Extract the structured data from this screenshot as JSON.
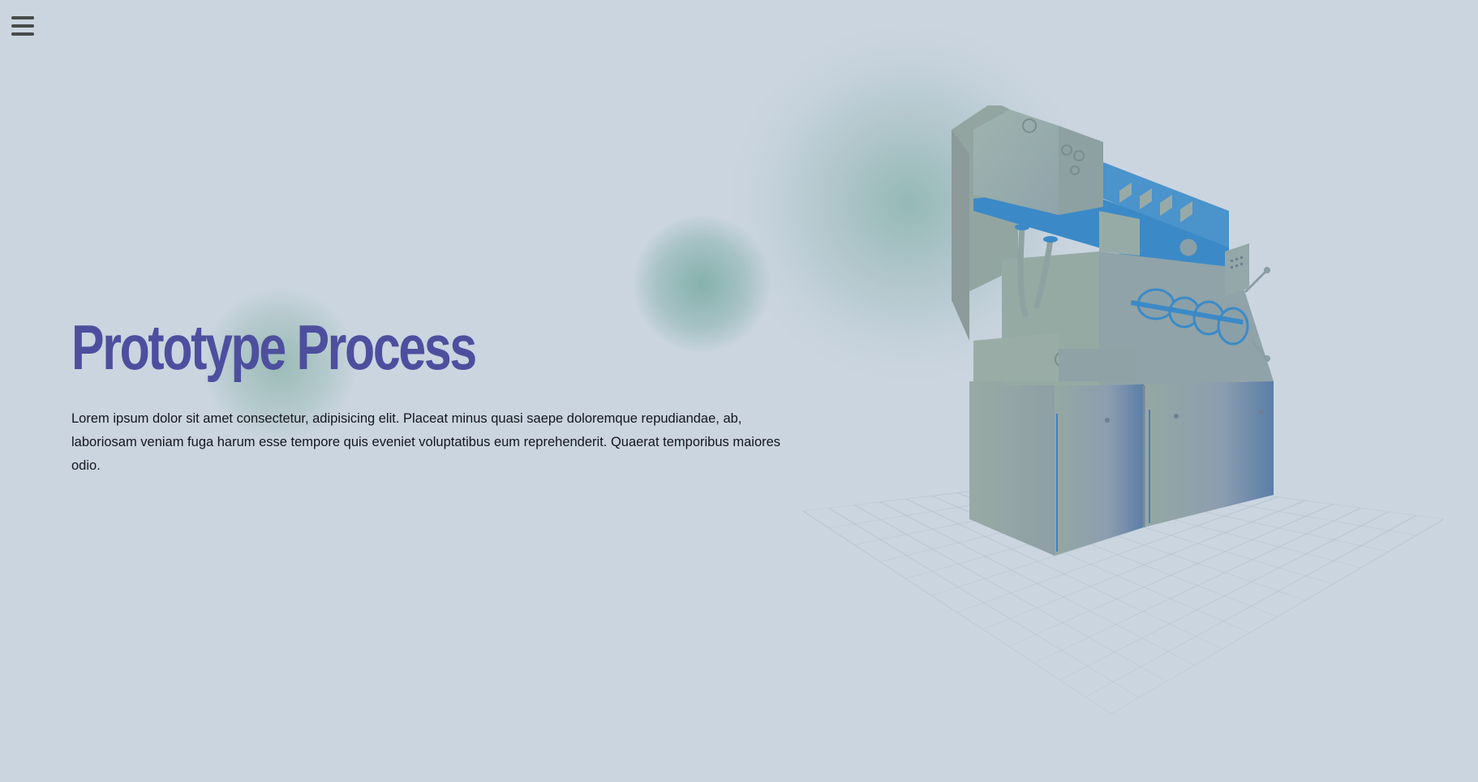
{
  "nav": {
    "menu_icon": "hamburger-menu-icon"
  },
  "hero": {
    "title": "Prototype Process",
    "description": "Lorem ipsum dolor sit amet consectetur, adipisicing elit. Placeat minus quasi saepe doloremque repudiandae, ab, laboriosam veniam fuga harum esse tempore quis eveniet voluptatibus eum reprehenderit. Quaerat temporibus maiores odio."
  },
  "scene": {
    "model_icon": "industrial-machine-3d-model",
    "floor_icon": "perspective-grid-floor"
  },
  "colors": {
    "background": "#cbd5e0",
    "title": "#4d4f9e",
    "text": "#14151c",
    "accent_blue": "#3b88c4",
    "machine_green": "#93a9a0"
  }
}
